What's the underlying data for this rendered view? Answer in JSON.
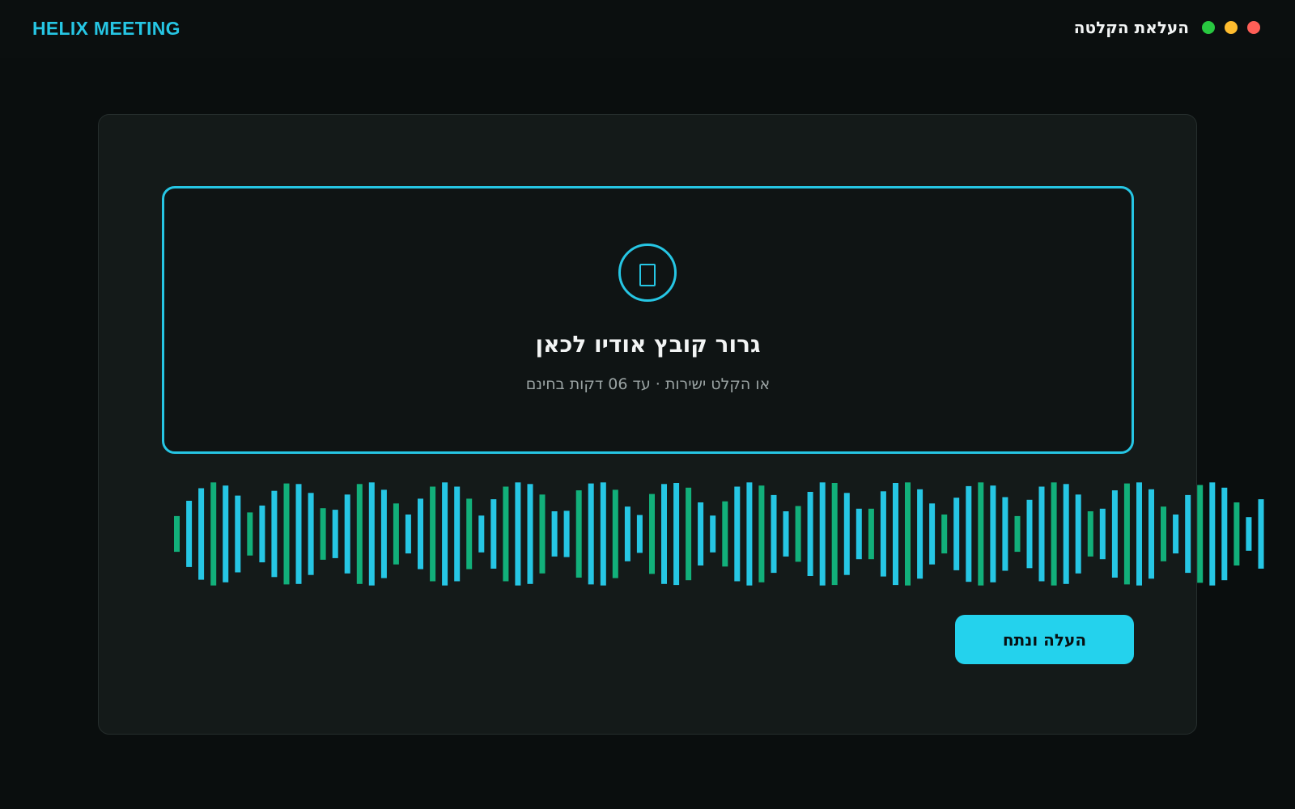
{
  "app": {
    "brand": "HELIX MEETING",
    "window_title": "העלאת הקלטה",
    "window_controls": [
      {
        "name": "close",
        "color": "#ff5f57"
      },
      {
        "name": "minimize",
        "color": "#febc2e"
      },
      {
        "name": "maximize",
        "color": "#28c840"
      }
    ]
  },
  "dropzone": {
    "icon": "upload-icon",
    "title": "גרור קובץ אודיו לכאן",
    "subtitle": "או הקלט ישירות · עד 06 דקות בחינם"
  },
  "waveform": {
    "colors": {
      "primary": "#26c6e4",
      "secondary": "#12b07a"
    },
    "levels": [
      0.34,
      0.63,
      0.87,
      0.98,
      0.92,
      0.73,
      0.41,
      0.54,
      0.82,
      0.96,
      0.95,
      0.78,
      0.49,
      0.46,
      0.75,
      0.95,
      0.98,
      0.84,
      0.58,
      0.37,
      0.67,
      0.9,
      0.98,
      0.9,
      0.67,
      0.35,
      0.66,
      0.9,
      0.98,
      0.95,
      0.75,
      0.43,
      0.44,
      0.83,
      0.96,
      0.98,
      0.84,
      0.52,
      0.36,
      0.76,
      0.95,
      0.97,
      0.88,
      0.6,
      0.35,
      0.62,
      0.9,
      0.98,
      0.92,
      0.74,
      0.43,
      0.53,
      0.8,
      0.98,
      0.97,
      0.78,
      0.48,
      0.48,
      0.81,
      0.97,
      0.98,
      0.85,
      0.58,
      0.37,
      0.69,
      0.91,
      0.98,
      0.92,
      0.7,
      0.34,
      0.65,
      0.9,
      0.98,
      0.95,
      0.75,
      0.43,
      0.48,
      0.83,
      0.96,
      0.98,
      0.85,
      0.52,
      0.37,
      0.74,
      0.93,
      0.98,
      0.88,
      0.6,
      0.32,
      0.66
    ]
  },
  "actions": {
    "upload_label": "העלה ונתח",
    "accent": "#24d2ed"
  }
}
